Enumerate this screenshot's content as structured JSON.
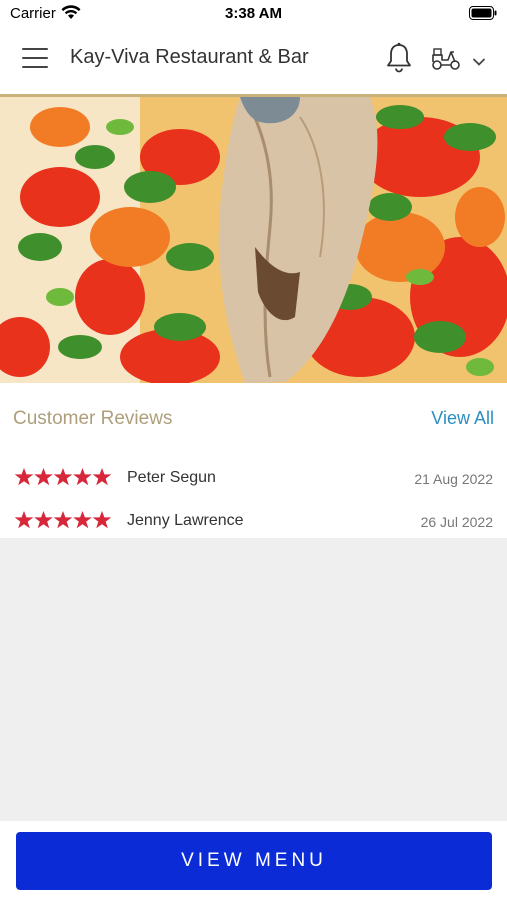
{
  "status_bar": {
    "carrier": "Carrier",
    "time": "3:38 AM",
    "icons": [
      "wifi-icon",
      "battery-icon"
    ]
  },
  "header": {
    "title": "Kay-Viva Restaurant & Bar",
    "icons": [
      "hamburger-menu-icon",
      "bell-icon",
      "delivery-scooter-icon",
      "chevron-down-icon"
    ]
  },
  "hero": {
    "description_icon": "food-photo"
  },
  "reviews": {
    "title": "Customer Reviews",
    "view_all_label": "View All",
    "items": [
      {
        "rating": 5,
        "name": "Peter Segun",
        "date": "21 Aug 2022"
      },
      {
        "rating": 5,
        "name": "Jenny Lawrence",
        "date": "26 Jul 2022"
      }
    ]
  },
  "footer": {
    "button_label": "VIEW MENU"
  },
  "colors": {
    "accent_blue": "#0a2bd6",
    "link_blue": "#2d8fc1",
    "star_red": "#d6283a",
    "gold": "#ae9f7c",
    "background_grey": "#efefef"
  }
}
